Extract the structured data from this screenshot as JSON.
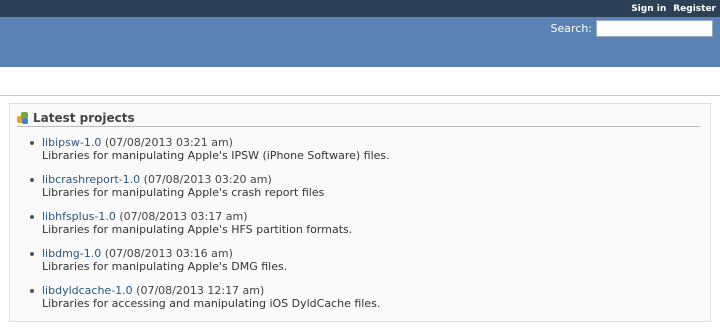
{
  "top_menu": {
    "sign_in": "Sign in",
    "register": "Register"
  },
  "header": {
    "search_label": "Search:",
    "search_value": ""
  },
  "latest_projects": {
    "title": "Latest projects",
    "items": [
      {
        "name": "libipsw-1.0",
        "date": "(07/08/2013 03:21 am)",
        "description": "Libraries for manipulating Apple's IPSW (iPhone Software) files."
      },
      {
        "name": "libcrashreport-1.0",
        "date": "(07/08/2013 03:20 am)",
        "description": "Libraries for manipulating Apple's crash report files"
      },
      {
        "name": "libhfsplus-1.0",
        "date": "(07/08/2013 03:17 am)",
        "description": "Libraries for manipulating Apple's HFS partition formats."
      },
      {
        "name": "libdmg-1.0",
        "date": "(07/08/2013 03:16 am)",
        "description": "Libraries for manipulating Apple's DMG files."
      },
      {
        "name": "libdyldcache-1.0",
        "date": "(07/08/2013 12:17 am)",
        "description": "Libraries for accessing and manipulating iOS DyldCache files."
      }
    ]
  },
  "colors": {
    "top_menu_bg": "#2c4056",
    "header_bg": "#5a83b5",
    "link": "#2a5685"
  }
}
